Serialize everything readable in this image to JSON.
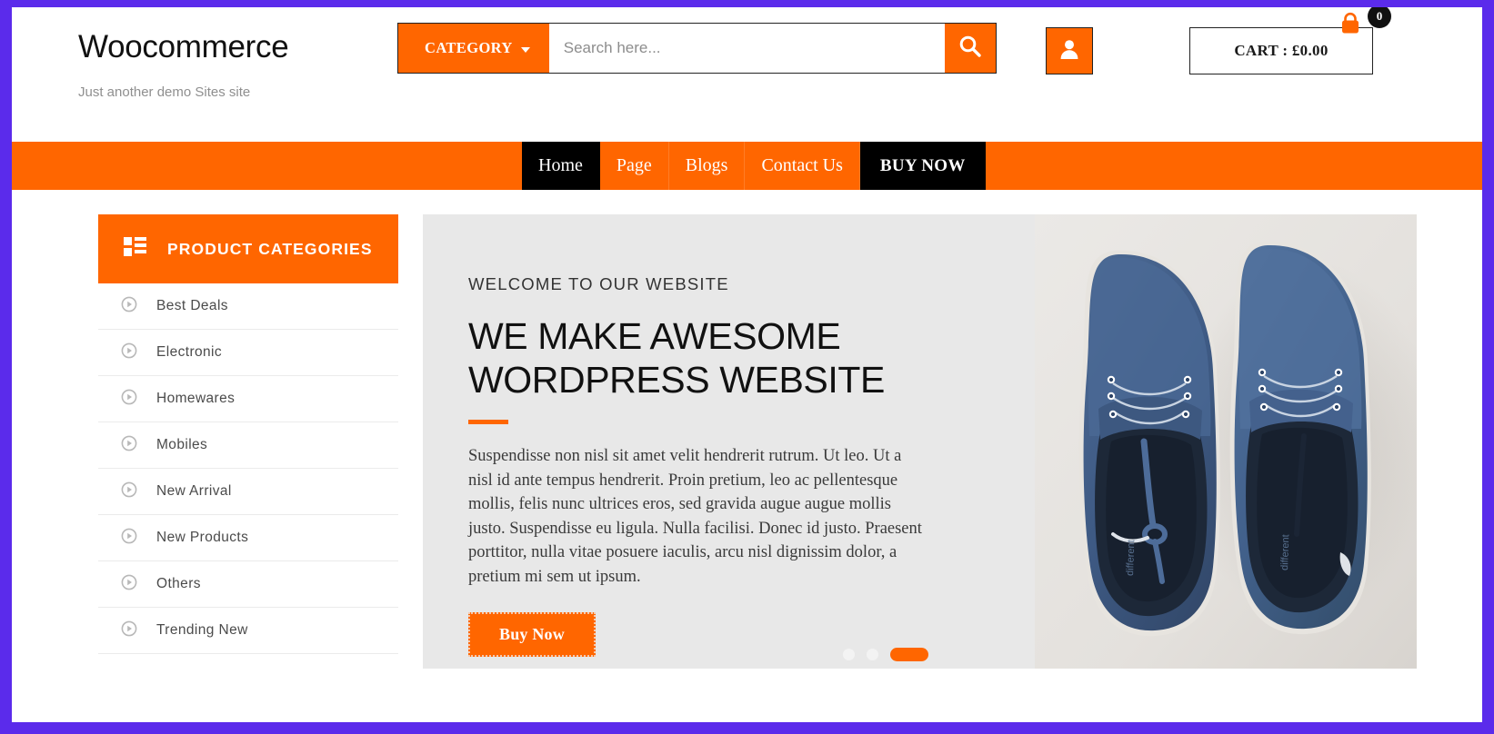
{
  "theme": {
    "accent": "#FF6600",
    "page_border": "#5B2BEB",
    "dark": "#000000",
    "hero_bg": "#e8e8e8"
  },
  "header": {
    "brand_title": "Woocommerce",
    "brand_tagline": "Just another demo Sites site",
    "category_button": "CATEGORY",
    "search_placeholder": "Search here...",
    "search_value": "",
    "search_icon": "search-icon",
    "account_icon": "user-icon",
    "cart_label": "CART : £0.00",
    "cart_count": "0",
    "cart_icon": "shopping-bag-icon"
  },
  "nav": {
    "items": [
      {
        "label": "Home",
        "state": "active"
      },
      {
        "label": "Page",
        "state": "normal"
      },
      {
        "label": "Blogs",
        "state": "normal"
      },
      {
        "label": "Contact Us",
        "state": "normal"
      },
      {
        "label": "BUY NOW",
        "state": "cta"
      }
    ]
  },
  "sidebar": {
    "heading": "PRODUCT CATEGORIES",
    "heading_icon": "grid-list-icon",
    "items": [
      {
        "label": "Best Deals",
        "icon": "play-circle-icon"
      },
      {
        "label": "Electronic",
        "icon": "play-circle-icon"
      },
      {
        "label": "Homewares",
        "icon": "play-circle-icon"
      },
      {
        "label": "Mobiles",
        "icon": "play-circle-icon"
      },
      {
        "label": "New Arrival",
        "icon": "play-circle-icon"
      },
      {
        "label": "New Products",
        "icon": "play-circle-icon"
      },
      {
        "label": "Others",
        "icon": "play-circle-icon"
      },
      {
        "label": "Trending New",
        "icon": "play-circle-icon"
      }
    ]
  },
  "hero": {
    "eyebrow": "WELCOME TO OUR WEBSITE",
    "title_line1": "WE MAKE AWESOME",
    "title_line2": "WORDPRESS WEBSITE",
    "paragraph": "Suspendisse non nisl sit amet velit hendrerit rutrum. Ut leo. Ut a nisl id ante tempus hendrerit. Proin pretium, leo ac pellentesque mollis, felis nunc ultrices eros, sed gravida augue augue mollis justo. Suspendisse eu ligula. Nulla facilisi. Donec id justo. Praesent porttitor, nulla vitae posuere iaculis, arcu nisl dignissim dolor, a pretium mi sem ut ipsum.",
    "button_label": "Buy Now",
    "image_alt": "blue canvas sneakers pair",
    "slider_dots": [
      {
        "state": "inactive"
      },
      {
        "state": "inactive"
      },
      {
        "state": "active"
      }
    ]
  }
}
